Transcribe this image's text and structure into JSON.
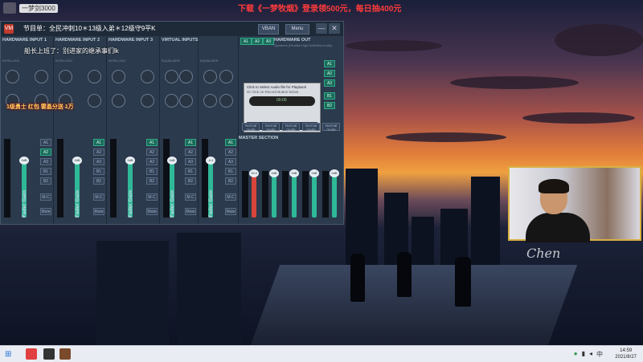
{
  "stream": {
    "top_banner": "下载《一梦牧烟》登录领500元，每日抽400元",
    "top_left_user": "一梦剑3000",
    "danmu": [
      "节目单：全民冲刺10＊13级入弟＊12级守9平K",
      "船长上班了：别进家的继承事们lk"
    ],
    "effect_text": "1级勇士 红包 雷晶分送 1万"
  },
  "voicemeeter": {
    "logo": "VM",
    "vban_label": "VBAN",
    "menu_label": "Menu",
    "minimize_glyph": "—",
    "close_glyph": "✕",
    "strips": [
      {
        "header": "HARDWARE INPUT 1",
        "sub": "INTELLIGO",
        "label": "Fader Gain",
        "gain": "0dB",
        "a1": false,
        "a2": true
      },
      {
        "header": "HARDWARE INPUT 2",
        "sub": "INTELLIGO",
        "label": "Fader Gain",
        "gain": "0dB",
        "a1": true,
        "a2": false
      },
      {
        "header": "HARDWARE INPUT 3",
        "sub": "INTELLIGO",
        "label": "Fader Gain",
        "gain": "0dB",
        "a1": true,
        "a2": false
      },
      {
        "header": "VIRTUAL INPUTS",
        "sub": "EQUALIZER",
        "label": "Fader Gain",
        "gain": "0dB",
        "a1": true,
        "a2": false
      },
      {
        "header": "",
        "sub": "EQUALIZER",
        "label": "Fader Gain",
        "gain": "-0.4",
        "a1": true,
        "a2": false
      }
    ],
    "bus_labels": [
      "A1",
      "A2",
      "A3",
      "B1",
      "B2"
    ],
    "mc_label": "M.C",
    "mute_label": "Mute",
    "output_header": "HARDWARE OUT",
    "output_sub": "Speakers (Realtek High Definition Audio)",
    "ab_buttons": [
      "A1",
      "A2",
      "A3"
    ],
    "player": {
      "title": "Click to Select Audio file for Playback",
      "subtitle": "Or click on Record Button below",
      "time": "00:00"
    },
    "master_title": "MASTER SECTION",
    "master_strips": [
      {
        "label": "Normal mode",
        "gain": "15.0",
        "red": true
      },
      {
        "label": "Normal mode",
        "gain": "0dB",
        "red": false
      },
      {
        "label": "Normal mode",
        "gain": "0dB",
        "red": false
      },
      {
        "label": "Normal mode",
        "gain": "0dB",
        "red": false
      },
      {
        "label": "Normal mode",
        "gain": "0dB",
        "red": false
      }
    ],
    "master_fader_label": "Fader Gain"
  },
  "webcam": {
    "signature": "Chen"
  },
  "taskbar": {
    "start_icon": "windows-icon",
    "clock_time": "14:59",
    "clock_date": "2021/8/27"
  },
  "colors": {
    "accent": "#2fb898",
    "danger": "#d8453a",
    "frame": "#d8b040"
  }
}
